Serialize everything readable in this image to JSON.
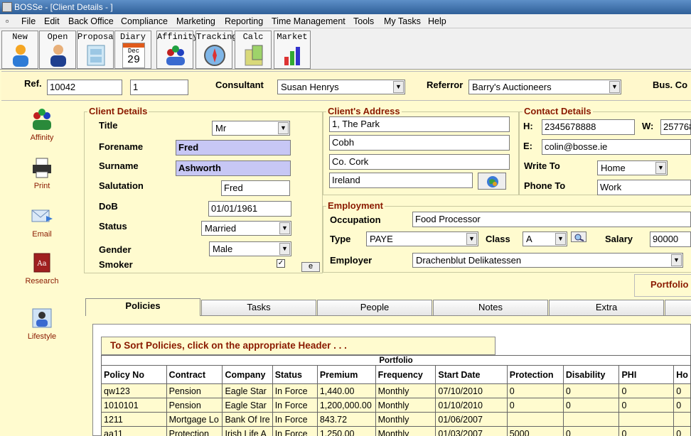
{
  "window": {
    "title": "BOSSe - [Client Details - ]"
  },
  "menu": [
    "File",
    "Edit",
    "Back Office",
    "Compliance",
    "Marketing",
    "Reporting",
    "Time Management",
    "Tools",
    "My Tasks",
    "Help"
  ],
  "toolbar": {
    "new": "New",
    "open": "Open",
    "proposal": "Proposal",
    "diary": "Diary",
    "diary_month": "Dec",
    "diary_day": "29",
    "affinity": "Affinity",
    "tracking": "Tracking",
    "calc": "Calc",
    "market": "Market"
  },
  "ref": {
    "label": "Ref.",
    "value": "10042",
    "sub_value": "1",
    "consultant_label": "Consultant",
    "consultant": "Susan Henrys",
    "referror_label": "Referror",
    "referror": "Barry's Auctioneers",
    "bus_label": "Bus. Co"
  },
  "sidebar": [
    "Affinity",
    "Print",
    "Email",
    "Research",
    "Lifestyle"
  ],
  "client": {
    "section": "Client Details",
    "title_label": "Title",
    "title": "Mr",
    "forename_label": "Forename",
    "forename": "Fred",
    "surname_label": "Surname",
    "surname": "Ashworth",
    "salutation_label": "Salutation",
    "salutation": "Fred",
    "dob_label": "DoB",
    "dob": "01/01/1961",
    "status_label": "Status",
    "status": "Married",
    "gender_label": "Gender",
    "gender": "Male",
    "smoker_label": "Smoker",
    "smoker_check": "✓",
    "e_button": "e"
  },
  "address": {
    "section": "Client's Address",
    "line1": "1, The Park",
    "line2": "Cobh",
    "line3": "Co. Cork",
    "line4": "Ireland"
  },
  "contact": {
    "section": "Contact Details",
    "h_label": "H:",
    "h": "2345678888",
    "w_label": "W:",
    "w": "257768",
    "e_label": "E:",
    "e": "colin@bosse.ie",
    "write_label": "Write To",
    "write": "Home",
    "phone_label": "Phone To",
    "phone": "Work"
  },
  "employment": {
    "section": "Employment",
    "occupation_label": "Occupation",
    "occupation": "Food Processor",
    "type_label": "Type",
    "type": "PAYE",
    "class_label": "Class",
    "class": "A",
    "salary_label": "Salary",
    "salary": "90000",
    "employer_label": "Employer",
    "employer": "Drachenblut Delikatessen",
    "portfolio_label": "Portfolio"
  },
  "tabs": [
    "Policies",
    "Tasks",
    "People",
    "Notes",
    "Extra"
  ],
  "policies": {
    "sort_hint": "To Sort Policies, click on the appropriate Header . . .",
    "portfolio_title": "Portfolio",
    "columns": [
      "Policy No",
      "Contract",
      "Company",
      "Status",
      "Premium",
      "Frequency",
      "Start Date",
      "Protection",
      "Disability",
      "PHI",
      "Ho"
    ],
    "rows": [
      [
        "qw123",
        "Pension",
        "Eagle Star",
        "In Force",
        "1,440.00",
        "Monthly",
        "07/10/2010",
        "0",
        "0",
        "0",
        "0"
      ],
      [
        "1010101",
        "Pension",
        "Eagle Star",
        "In Force",
        "1,200,000.00",
        "Monthly",
        "01/10/2010",
        "0",
        "0",
        "0",
        "0"
      ],
      [
        "1211",
        "Mortgage Lo",
        "Bank Of Ire",
        "In Force",
        "843.72",
        "Monthly",
        "01/06/2007",
        "",
        "",
        "",
        ""
      ],
      [
        "aa11",
        "Protection",
        "Irish Life A",
        "In Force",
        "1,250.00",
        "Monthly",
        "01/03/2007",
        "5000",
        "0",
        "0",
        "0"
      ]
    ]
  },
  "colors": {
    "accent_label": "#8a1a00",
    "panel_bg": "#fffbcf",
    "highlight_field": "#c7c7f5"
  }
}
